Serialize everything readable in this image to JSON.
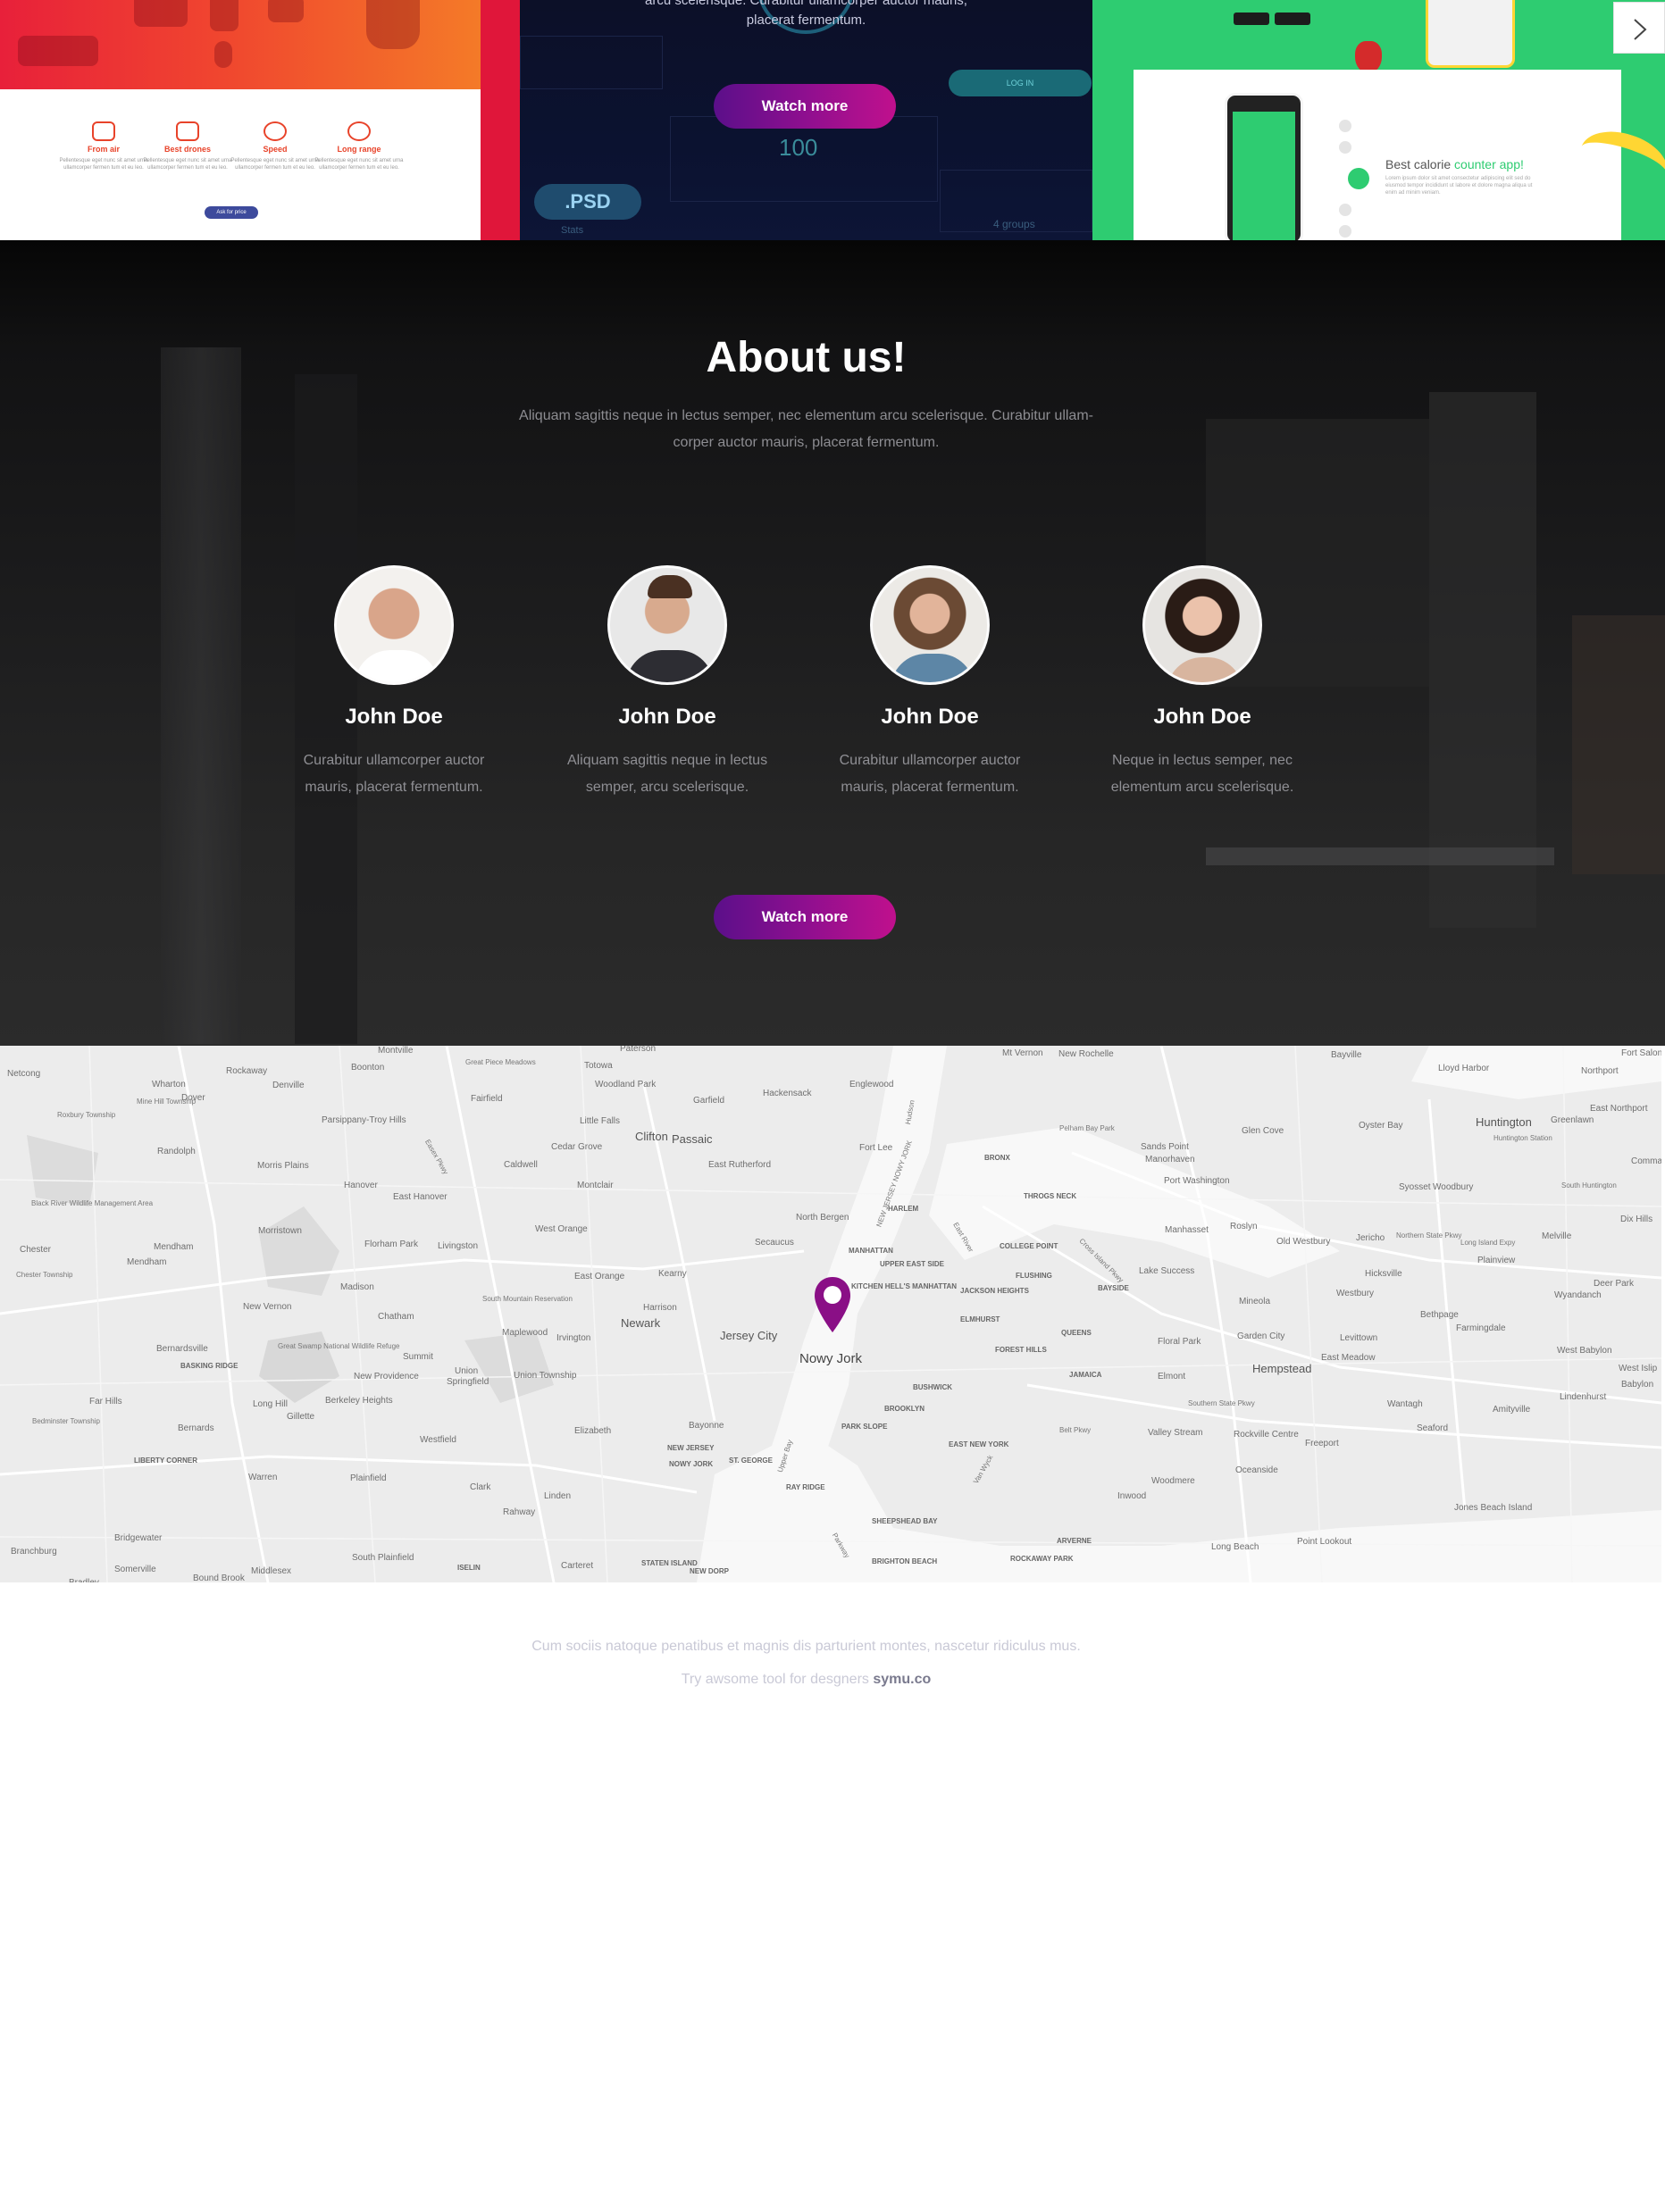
{
  "colors": {
    "accent_gradient_start": "#5b0f8a",
    "accent_gradient_end": "#c0108d",
    "marker": "#8a0f86",
    "green_tile": "#2ecc71",
    "red_tile": "#e8203a"
  },
  "portfolio": {
    "red_tile": {
      "features": [
        {
          "title": "From air",
          "desc": "Pellentesque eget nunc sit amet urna ullamcorper fermen tum et eu leo."
        },
        {
          "title": "Best drones",
          "desc": "Pellentesque eget nunc sit amet urna ullamcorper fermen tum et eu leo."
        },
        {
          "title": "Speed",
          "desc": "Pellentesque eget nunc sit amet urna ullamcorper fermen tum et eu leo."
        },
        {
          "title": "Long range",
          "desc": "Pellentesque eget nunc sit amet urna ullamcorper fermen tum et eu leo."
        }
      ],
      "button": "Ask for price"
    },
    "dark_tile": {
      "text_line1": "arcu scelerisque. Curabitur ullamcorper auctor mauris,",
      "text_line2": "placerat fermentum.",
      "watch_button": "Watch more",
      "login_button": "LOG IN",
      "counter": "100",
      "psd_badge": ".PSD",
      "stats_label": "Stats",
      "groups_label": "4 groups"
    },
    "green_tile": {
      "headline_plain": "Best calorie ",
      "headline_accent": "counter app!",
      "desc": "Lorem ipsum dolor sit amet consectetur adipiscing elit sed do eiusmod tempor incididunt ut labore et dolore magna aliqua ut enim ad minim veniam."
    },
    "next_icon": "chevron-right-icon"
  },
  "about": {
    "title": "About us!",
    "subtitle_line1": "Aliquam sagittis neque in lectus semper, nec elementum arcu scelerisque. Curabitur ullam-",
    "subtitle_line2": "corper auctor mauris, placerat fermentum.",
    "members": [
      {
        "name": "John Doe",
        "desc_line1": "Curabitur ullamcorper auctor",
        "desc_line2": "mauris, placerat fermentum."
      },
      {
        "name": "John Doe",
        "desc_line1": "Aliquam sagittis neque in lectus",
        "desc_line2": "semper, arcu scelerisque."
      },
      {
        "name": "John Doe",
        "desc_line1": "Curabitur ullamcorper auctor",
        "desc_line2": "mauris, placerat fermentum."
      },
      {
        "name": "John Doe",
        "desc_line1": "Neque in lectus semper, nec",
        "desc_line2": "elementum arcu scelerisque."
      }
    ],
    "watch_button": "Watch more"
  },
  "map": {
    "marker_label": "Nowy Jork",
    "places": [
      "Montville",
      "Paterson",
      "Mt Vernon",
      "New Rochelle",
      "Bayville",
      "Fort Salonga",
      "Netcong",
      "Rockaway",
      "Boonton",
      "Great Piece Meadows",
      "Totowa",
      "Lloyd Harbor",
      "Northport",
      "Wharton",
      "Denville",
      "Woodland Park",
      "Englewood",
      "Mine Hill Township",
      "Dover",
      "Fairfield",
      "Garfield",
      "Hackensack",
      "East Northport",
      "Roxbury Township",
      "Parsippany-Troy Hills",
      "Little Falls",
      "Pelham Bay Park",
      "Glen Cove",
      "Oyster Bay",
      "Huntington",
      "Greenlawn",
      "Clifton",
      "Passaic",
      "Fort Lee",
      "Huntington Station",
      "Randolph",
      "Cedar Grove",
      "Sands Point",
      "Manorhasset",
      "Commack",
      "Morris Plains",
      "Caldwell",
      "East Rutherford",
      "BRONX",
      "Port Washington",
      "Syosset",
      "Woodbury",
      "South Huntington",
      "Hanover",
      "Montclair",
      "THROGS NECK",
      "Black River Wildlife Management Area",
      "East Hanover",
      "HARLEM",
      "North Bergen",
      "Dix Hills",
      "Roslyn",
      "Manhasset",
      "Melville",
      "Chester",
      "Morristown",
      "West Orange",
      "Secaucus",
      "Jericho",
      "Old Westbury",
      "Northern State Pkwy",
      "Long Island Expy",
      "Mendham",
      "Florham Park",
      "Livingston",
      "MANHATTAN",
      "COLLEGE POINT",
      "Plainview",
      "Chester Township",
      "UPPER EAST SIDE",
      "Hicksville",
      "Lake Success",
      "FLUSHING",
      "Kearny",
      "East Orange",
      "Deer Park",
      "Wyandanch",
      "Madison",
      "KITCHEN HELL'S MANHATTAN",
      "JACKSON HEIGHTS",
      "BAYSIDE",
      "Westbury",
      "Mineola",
      "New Vernon",
      "South Mountain Reservation",
      "Harrison",
      "Chatham",
      "Newark",
      "Jersey City",
      "ELMHURST",
      "Bethpage",
      "Farmingdale",
      "QUEENS",
      "Floral Park",
      "Garden City",
      "Levittown",
      "Maplewood",
      "Irvington",
      "FOREST HILLS",
      "West Babylon",
      "Bernardsville",
      "Great Swamp National Wildlife Refuge",
      "Summit",
      "East Meadow",
      "West Islip",
      "BASKING RIDGE",
      "Hempstead",
      "Babylon",
      "New Providence",
      "Union Township",
      "Elmont",
      "JAMAICA",
      "Union",
      "Springfield",
      "Lindenhurst",
      "BUSHWICK",
      "Far Hills",
      "Long Hill",
      "Berkeley Heights",
      "Wantagh",
      "Amityville",
      "Southern State Pkwy",
      "BROOKLYN",
      "Gillette",
      "Elizabeth",
      "Bayonne",
      "Valley Stream",
      "Rockville Centre",
      "Seaford",
      "Freeport",
      "PARK SLOPE",
      "Bedminster Township",
      "Bernards",
      "Westfield",
      "NEW JERSEY",
      "EAST NEW YORK",
      "LIBERTY CORNER",
      "NOWY JORK",
      "ST. GEORGE",
      "Oceanside",
      "Warren",
      "Plainfield",
      "Clark",
      "Woodmere",
      "RAY RIDGE",
      "Linden",
      "Inwood",
      "Rahway",
      "SHEEPSHEAD BAY",
      "Jones Beach Island",
      "Bridgewater",
      "ARVERNE",
      "Point Lookout",
      "Branchburg",
      "Long Beach",
      "South Plainfield",
      "Carteret",
      "STATEN ISLAND",
      "ROCKAWAY PARK",
      "BRIGHTON BEACH",
      "Somerville",
      "Middlesex",
      "ISELIN",
      "NEW DORP",
      "Bound Brook",
      "Bradley",
      "Upper Bay",
      "Belt Pkwy",
      "Cross Island Pkwy",
      "East River",
      "Hudson",
      "Easex Pkwy",
      "Van Wyck",
      "NEW JERSEY NOWY JORK",
      "Parkway"
    ]
  },
  "footer": {
    "line1": "Cum sociis natoque penatibus et magnis dis parturient montes, nascetur ridiculus mus.",
    "line2_prefix": "Try awsome tool for desgners ",
    "line2_brand": "symu.co"
  }
}
